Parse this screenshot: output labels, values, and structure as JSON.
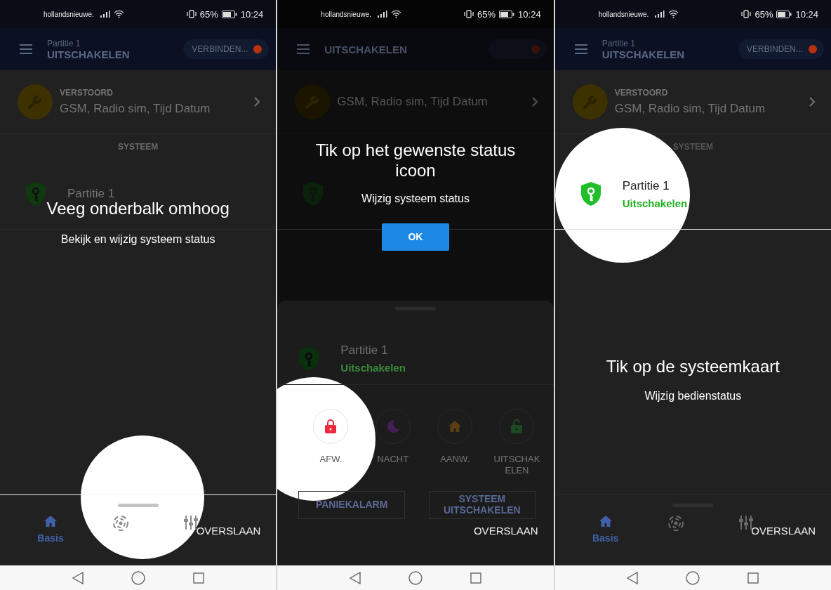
{
  "screens": [
    {
      "kind": "swipe_hint",
      "status_bar": {
        "carrier": "hollandsnieuwe.",
        "battery": "65%",
        "time": "10:24"
      },
      "app_bar": {
        "subtitle": "Partitie 1",
        "title": "UITSCHAKELEN",
        "connect_label": "VERBINDEN..."
      },
      "alert": {
        "label": "VERSTOORD",
        "text": "GSM, Radio sim, Tijd Datum"
      },
      "section": "SYSTEEM",
      "partition": {
        "name": "Partitie 1",
        "highlighted": false
      },
      "bottom_nav": {
        "highlighted": true,
        "items": [
          {
            "kind": "home",
            "label": "Basis",
            "selected": true
          },
          {
            "kind": "radar",
            "selected": false
          },
          {
            "kind": "sliders",
            "selected": false
          }
        ]
      },
      "coach": {
        "title": "Veeg onderbalk omhoog",
        "subtitle": "Bekijk en wijzig systeem status"
      },
      "skip": "OVERSLAAN"
    },
    {
      "kind": "choose_mode",
      "status_bar": {
        "carrier": "hollandsnieuwe.",
        "battery": "65%",
        "time": "10:24"
      },
      "app_bar": {
        "title": "UITSCHAKELEN"
      },
      "alert": {
        "text": "GSM, Radio sim, Tijd Datum"
      },
      "partition": {
        "highlighted": false
      },
      "sheet": {
        "partition": {
          "name": "Partitie 1",
          "status": "Uitschakelen"
        },
        "modes": [
          {
            "kind": "away",
            "label": "AFW.",
            "highlighted": true
          },
          {
            "kind": "night",
            "label": "NACHT",
            "highlighted": false
          },
          {
            "kind": "home",
            "label": "AANW.",
            "highlighted": false
          },
          {
            "kind": "disarm",
            "label": "UITSCHAKELEN",
            "highlighted": false
          }
        ],
        "buttons": [
          "PANIEKALARM",
          "SYSTEEM UITSCHAKELEN"
        ]
      },
      "coach": {
        "title": "Tik op het gewenste status icoon",
        "subtitle": "Wijzig systeem status",
        "ok_button": "OK"
      },
      "skip": "OVERSLAAN"
    },
    {
      "kind": "tap_card",
      "status_bar": {
        "carrier": "hollandsnieuwe.",
        "battery": "65%",
        "time": "10:24"
      },
      "app_bar": {
        "subtitle": "Partitie 1",
        "title": "UITSCHAKELEN",
        "connect_label": "VERBINDEN..."
      },
      "alert": {
        "label": "VERSTOORD",
        "text": "GSM, Radio sim, Tijd Datum"
      },
      "section": "SYSTEEM",
      "partition": {
        "name": "Partitie 1",
        "status": "Uitschakelen",
        "highlighted": true
      },
      "bottom_nav": {
        "highlighted": false,
        "items": [
          {
            "kind": "home",
            "label": "Basis",
            "selected": true
          },
          {
            "kind": "radar",
            "selected": false
          },
          {
            "kind": "sliders",
            "selected": false
          }
        ]
      },
      "coach": {
        "title": "Tik op de systeemkaart",
        "subtitle": "Wijzig bedienstatus"
      },
      "skip": "OVERSLAAN"
    }
  ]
}
